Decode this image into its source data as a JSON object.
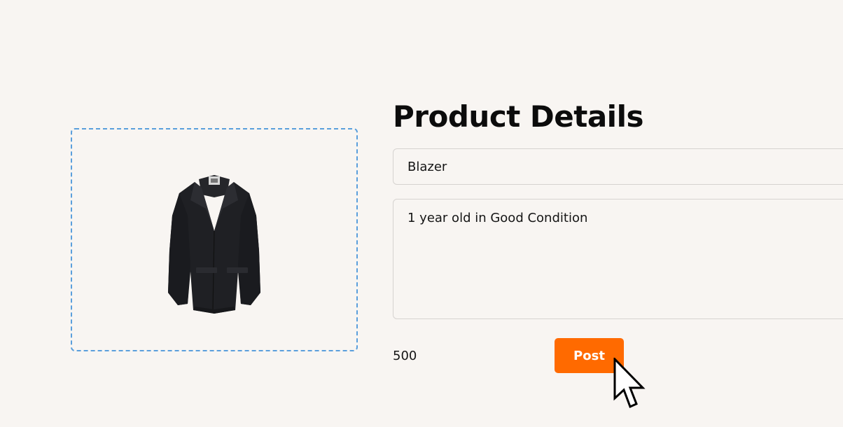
{
  "page": {
    "title": "Product Details"
  },
  "upload": {
    "image_icon": "blazer-jacket-image"
  },
  "form": {
    "name_value": "Blazer",
    "description_value": "1 year old in Good Condition",
    "price_value": "500",
    "post_label": "Post"
  },
  "colors": {
    "accent": "#ff6a00",
    "dropzone_border": "#5a9fdc",
    "background": "#f8f5f2"
  }
}
